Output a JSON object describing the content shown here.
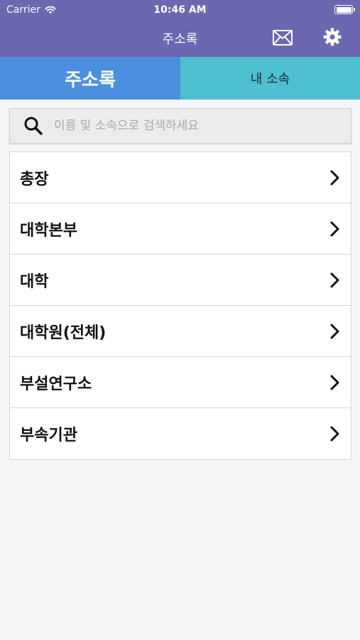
{
  "status_bar": {
    "carrier": "Carrier",
    "time": "10:46 AM"
  },
  "nav": {
    "title": "주소록",
    "color": "#6b67b0"
  },
  "tabs": [
    {
      "label": "주소록",
      "active": true,
      "color": "#4a8fe0"
    },
    {
      "label": "내 소속",
      "active": false,
      "color": "#4dc0d0"
    }
  ],
  "search": {
    "placeholder": "이름 및 소속으로 검색하세요"
  },
  "list": {
    "items": [
      {
        "label": "총장"
      },
      {
        "label": "대학본부"
      },
      {
        "label": "대학"
      },
      {
        "label": "대학원(전체)"
      },
      {
        "label": "부설연구소"
      },
      {
        "label": "부속기관"
      }
    ]
  },
  "icons": [
    "wifi-icon",
    "battery-icon",
    "mail-icon",
    "gear-icon",
    "search-icon",
    "chevron-right-icon"
  ]
}
